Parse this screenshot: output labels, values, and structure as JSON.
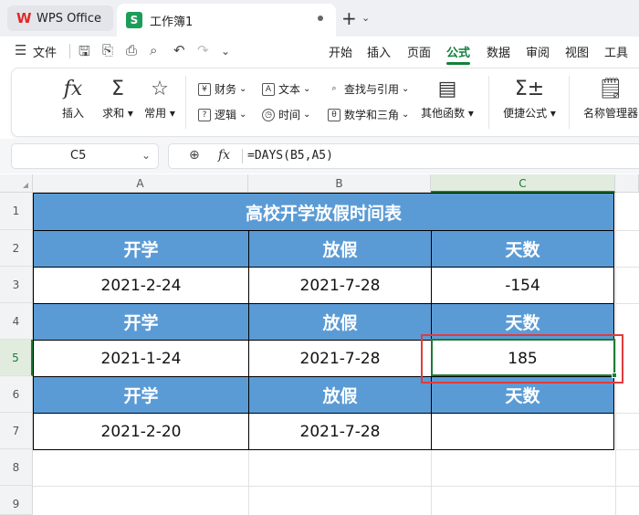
{
  "titlebar": {
    "app_tab": "WPS Office",
    "doc_tab": "工作簿1",
    "new_tab": "+",
    "new_tab_menu": "⌄"
  },
  "menubar": {
    "file": "文件",
    "tabs": [
      "开始",
      "插入",
      "页面",
      "公式",
      "数据",
      "审阅",
      "视图",
      "工具"
    ],
    "active_tab": "公式"
  },
  "ribbon": {
    "insert": "插入",
    "sum": "求和",
    "common": "常用",
    "finance": "财务",
    "text": "文本",
    "lookup": "查找与引用",
    "logic": "逻辑",
    "time": "时间",
    "math": "数学和三角",
    "other": "其他函数",
    "quick": "便捷公式",
    "names": "名称管理器"
  },
  "formula_bar": {
    "name_box": "C5",
    "formula": "=DAYS(B5,A5)"
  },
  "columns": [
    "A",
    "B",
    "C"
  ],
  "rows": [
    "1",
    "2",
    "3",
    "4",
    "5",
    "6",
    "7",
    "8",
    "9"
  ],
  "sheet": {
    "title": "高校开学放假时间表",
    "header_start": "开学",
    "header_vacation": "放假",
    "header_days": "天数",
    "r3": {
      "a": "2021-2-24",
      "b": "2021-7-28",
      "c": "-154"
    },
    "r5": {
      "a": "2021-1-24",
      "b": "2021-7-28",
      "c": "185"
    },
    "r7": {
      "a": "2021-2-20",
      "b": "2021-7-28",
      "c": ""
    }
  },
  "colors": {
    "header_fill": "#5b9bd5",
    "accent_green": "#12803b",
    "highlight_red": "#e23b3b"
  }
}
